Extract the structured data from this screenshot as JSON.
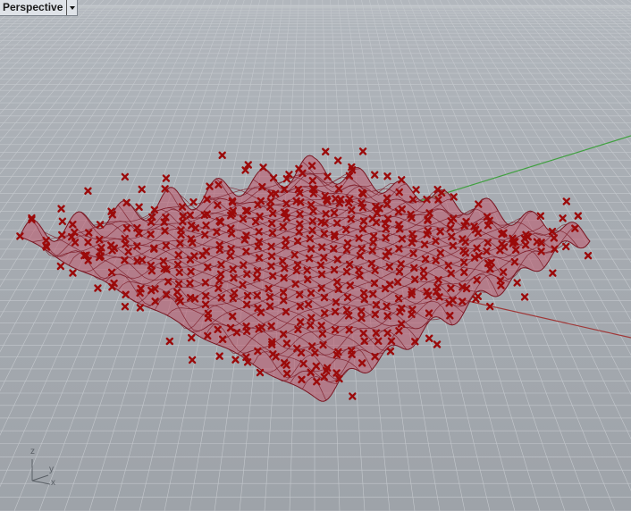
{
  "viewport": {
    "title": "Perspective",
    "menu_icon": "dropdown-triangle-icon"
  },
  "axes": {
    "x": "x",
    "y": "y",
    "z": "z"
  },
  "colors": {
    "background": "#a9aeb4",
    "grid": "#c4c8cd",
    "surface_fill": "#c0566a",
    "surface_line": "#7a1520",
    "control_point": "#9b0a0a",
    "x_axis": "#a03838",
    "y_axis": "#40a040"
  }
}
